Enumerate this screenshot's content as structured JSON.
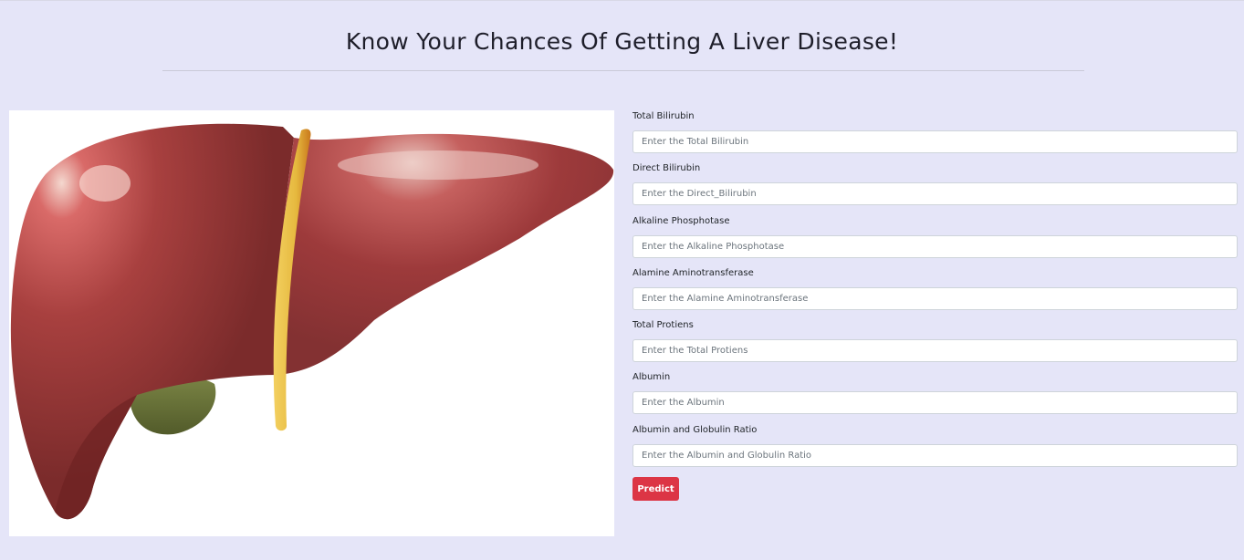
{
  "header": {
    "title": "Know Your Chances Of Getting A Liver Disease!"
  },
  "image": {
    "icon": "liver-illustration",
    "colors": {
      "liver": "#9a3a3a",
      "gallbladder": "#66703a",
      "ligament": "#e8c24a"
    }
  },
  "form": {
    "fields": [
      {
        "label": "Total Bilirubin",
        "placeholder": "Enter the Total Bilirubin",
        "value": ""
      },
      {
        "label": "Direct Bilirubin",
        "placeholder": "Enter the Direct_Bilirubin",
        "value": ""
      },
      {
        "label": "Alkaline Phosphotase",
        "placeholder": "Enter the Alkaline Phosphotase",
        "value": ""
      },
      {
        "label": "Alamine Aminotransferase",
        "placeholder": "Enter the Alamine Aminotransferase",
        "value": ""
      },
      {
        "label": "Total Protiens",
        "placeholder": "Enter the Total Protiens",
        "value": ""
      },
      {
        "label": "Albumin",
        "placeholder": "Enter the Albumin",
        "value": ""
      },
      {
        "label": "Albumin and Globulin Ratio",
        "placeholder": "Enter the Albumin and Globulin Ratio",
        "value": ""
      }
    ],
    "submit_label": "Predict"
  },
  "colors": {
    "background": "#e5e5f8",
    "button": "#dc3545"
  }
}
